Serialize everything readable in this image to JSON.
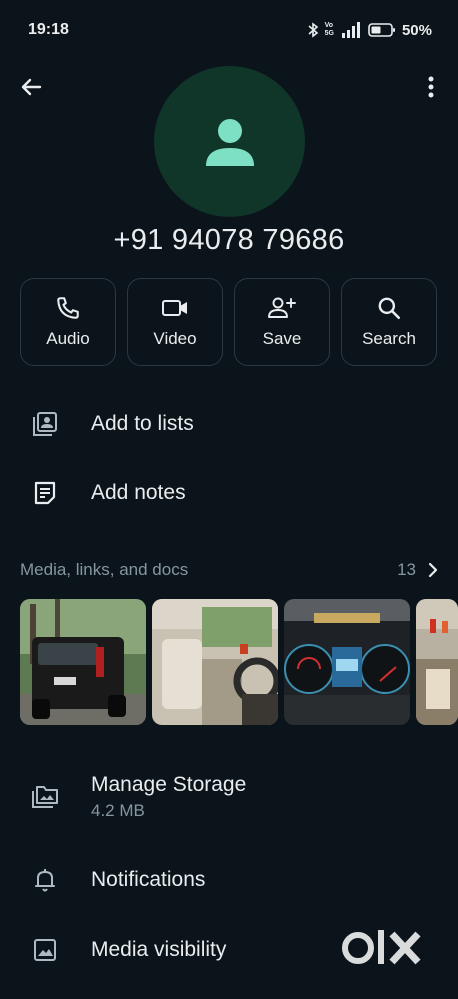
{
  "status": {
    "time": "19:18",
    "battery": "50%",
    "volte_top": "Vo",
    "volte_bottom": "5G"
  },
  "contact": {
    "phone": "+91 94078 79686"
  },
  "actions": [
    {
      "label": "Audio",
      "icon": "phone-icon"
    },
    {
      "label": "Video",
      "icon": "video-icon"
    },
    {
      "label": "Save",
      "icon": "add-person-icon"
    },
    {
      "label": "Search",
      "icon": "search-icon"
    }
  ],
  "menu": {
    "add_to_lists": "Add to lists",
    "add_notes": "Add notes"
  },
  "media": {
    "title": "Media, links, and docs",
    "count": "13"
  },
  "settings": {
    "manage_storage": "Manage Storage",
    "storage_size": "4.2 MB",
    "notifications": "Notifications",
    "media_visibility": "Media visibility"
  },
  "watermark": {
    "text": "OLX"
  },
  "colors": {
    "background": "#0b141a",
    "avatar_bg": "#103529",
    "avatar_icon": "#7de0c4",
    "accent": "#25d366"
  }
}
